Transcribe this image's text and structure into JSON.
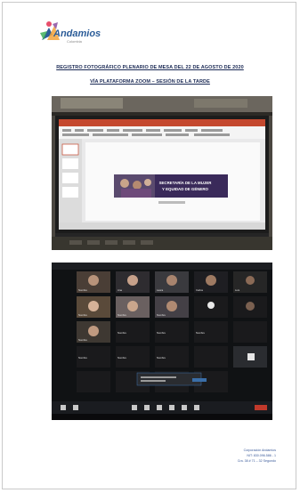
{
  "header": {
    "logo_text": "Andamios",
    "logo_sub": "Colombia"
  },
  "titles": {
    "line1": "REGISTRO FOTOGRÁFICO PLENARIO DE MESA DEL 22 DE AGOSTO DE 2020",
    "line2": "VÍA PLATAFORMA ZOOM – SESIÓN DE LA TARDE"
  },
  "photo1": {
    "banner_line1": "SECRETARÍA DE LA MUJER",
    "banner_line2": "Y EQUIDAD DE GÉNERO"
  },
  "photo2": {
    "participants": [
      "Nombre",
      "Ana",
      "Laura",
      "Carlos",
      "Luis",
      "",
      "Nombre",
      "Nombre",
      "Nombre",
      "Nombre",
      "Nombre",
      "Nombre",
      "Nombre",
      "Nombre",
      "Nombre",
      "Nombre"
    ]
  },
  "footer": {
    "line1": "Corporación Andamios",
    "line2": "NIT: 830.096.586 - 1",
    "line3": "Cra. 38 # 71 – 32 Segundo"
  }
}
